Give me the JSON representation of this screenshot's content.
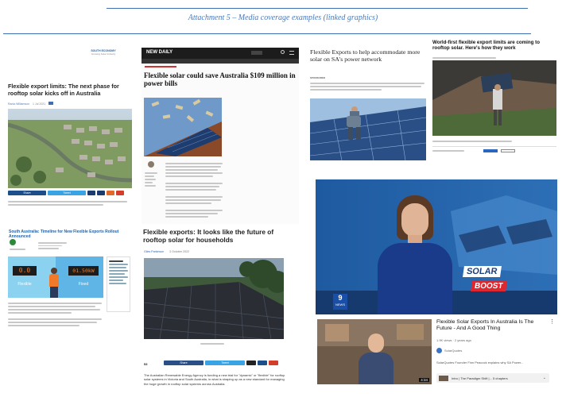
{
  "doc": {
    "title": "Attachment 5 – Media coverage examples (linked graphics)"
  },
  "art1": {
    "logo": "SOUTH ECONOMY",
    "logo_tag": "Growing Solar Industry",
    "headline": "Flexible export limits: The next phase for rooftop solar kicks off in Australia",
    "author": "Rania Williamson",
    "date": "1 Jul 2021",
    "share": "Share",
    "tweet": "Tweet"
  },
  "art2": {
    "brand": "NEW DAILY",
    "headline": "Flexible solar could save Australia $109 million in power bills"
  },
  "art3": {
    "headline": "Flexible Exports to help accommodate more solar on SA's power network",
    "tag": "SPONSORED"
  },
  "art4": {
    "headline": "World-first flexible export limits are coming to rooftop solar. Here's how they work"
  },
  "art5": {
    "headline": "South Australia: Timeline for New Flexible Exports Rollout Announced",
    "meter_left": "0.0",
    "meter_right": "01.50kW",
    "label_left": "Flexible",
    "label_right": "Fixed"
  },
  "art6": {
    "headline": "Flexible exports: It looks like the future of rooftop solar for households",
    "author": "Giles Parkinson",
    "date": "3 October 2022",
    "share_count": "53",
    "share": "Share",
    "tweet": "Tweet",
    "body": "The Australian Renewable Energy Agency is funding a new trial for \"dynamic\" or \"flexible\" for rooftop solar systems in Victoria and South Australia, in what is shaping up as a new standard for managing the huge growth in rooftop solar systems across Australia."
  },
  "video": {
    "badge_line1": "SOLAR",
    "badge_line2": "BOOST",
    "channel_logo": "9",
    "channel_name": "NEWS"
  },
  "yt": {
    "title": "Flexible Solar Exports In Australia Is The Future - And A Good Thing",
    "meta": "1.9K views · 2 years ago",
    "channel": "SolarQuotes",
    "desc": "SolarQuotes Founder Finn Peacock explains why SA Power...",
    "duration": "4:34",
    "chapters": "Intro | The Paradigm Shift |... 5 chapters"
  }
}
